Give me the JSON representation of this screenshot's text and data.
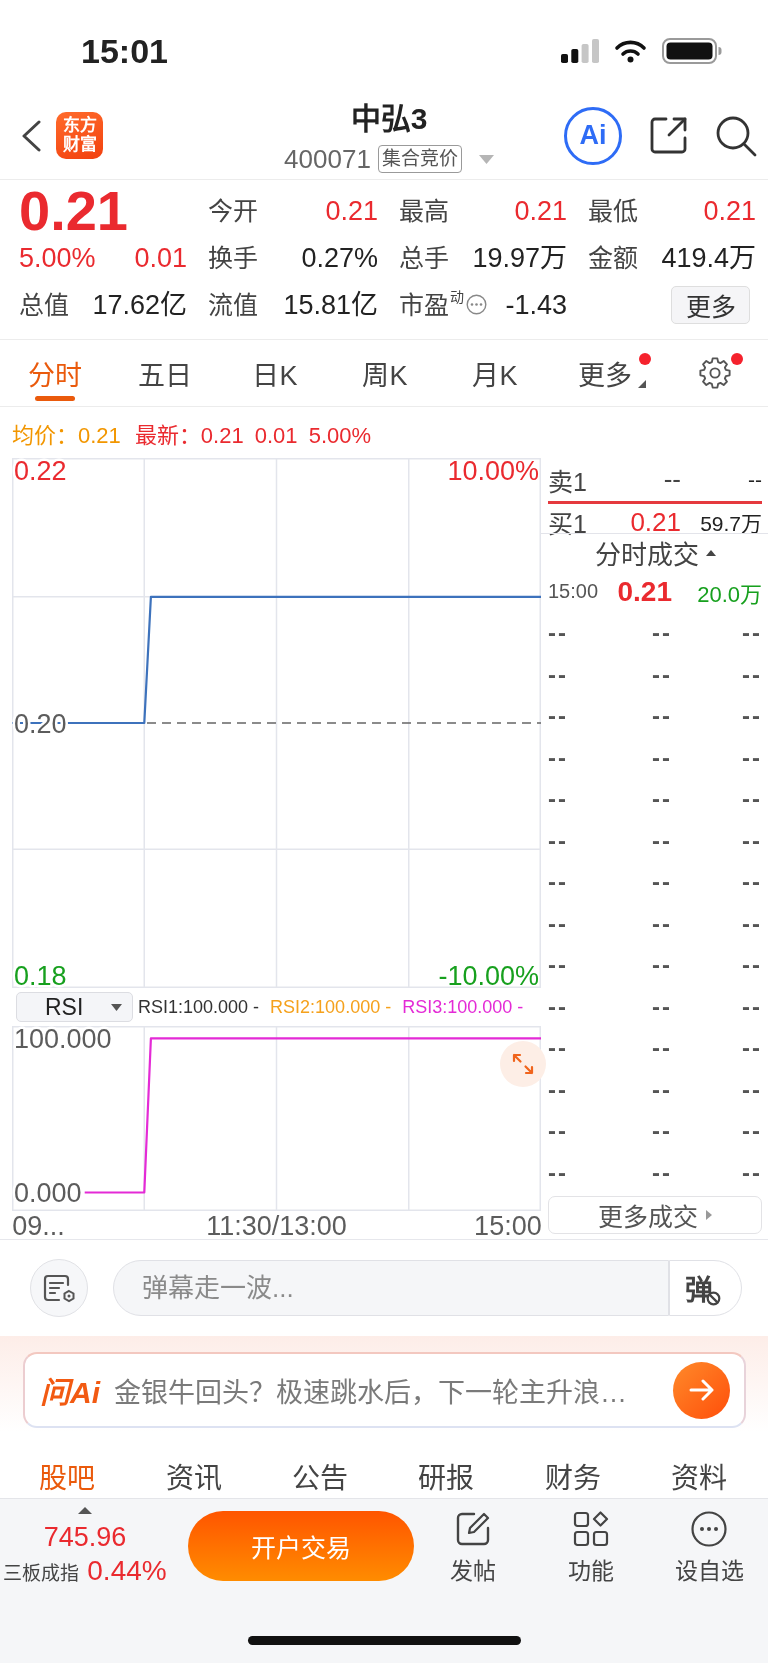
{
  "status_bar": {
    "time": "15:01"
  },
  "header": {
    "logo_text": "东方财富",
    "title": "中弘3",
    "code": "400071",
    "tag": "集合竞价",
    "ai_label": "Ai"
  },
  "quote": {
    "price": "0.21",
    "change_pct": "5.00%",
    "change": "0.01",
    "color": "#ea2a2f",
    "stats": [
      {
        "label": "今开",
        "value": "0.21",
        "color": "#ea2a2f"
      },
      {
        "label": "最高",
        "value": "0.21",
        "color": "#ea2a2f"
      },
      {
        "label": "最低",
        "value": "0.21",
        "color": "#ea2a2f"
      },
      {
        "label": "换手",
        "value": "0.27%",
        "color": "#222222"
      },
      {
        "label": "总手",
        "value": "19.97万",
        "color": "#222222"
      },
      {
        "label": "金额",
        "value": "419.4万",
        "color": "#222222"
      }
    ],
    "totals": [
      {
        "label": "总值",
        "value": "17.62亿"
      },
      {
        "label": "流值",
        "value": "15.81亿"
      },
      {
        "label": "市盈$^{动}$",
        "value": "-1.43",
        "hint_icon": true
      }
    ],
    "more_button": "更多"
  },
  "chart_tabs": [
    {
      "label": "分时",
      "selected": true,
      "kind": "tab",
      "dot": false
    },
    {
      "label": "五日",
      "selected": false,
      "kind": "tab",
      "dot": false
    },
    {
      "label": "日K",
      "selected": false,
      "kind": "tab",
      "dot": false
    },
    {
      "label": "周K",
      "selected": false,
      "kind": "tab",
      "dot": false
    },
    {
      "label": "月K",
      "selected": false,
      "kind": "tab",
      "dot": false
    },
    {
      "label": "更多",
      "selected": false,
      "kind": "menu",
      "dot": true
    }
  ],
  "settings": {
    "dot": true
  },
  "summary": [
    {
      "text": "均价：0.21",
      "color": "#f29600"
    },
    {
      "text": "最新：0.21 0.01 5.00%",
      "color": "#ea2a2f"
    }
  ],
  "price_chart": {
    "percent_labels": [
      {
        "text": "10.00%",
        "color": "#ea2a2f"
      },
      {
        "text": "-10.00%",
        "color": "#17a01e"
      }
    ],
    "chart_data": {
      "type": "line",
      "grid": true,
      "categories": [
        null,
        null,
        null,
        null,
        null,
        null,
        null,
        null,
        null,
        null,
        null,
        null,
        null,
        null,
        null,
        null,
        null,
        null,
        null,
        null,
        null,
        null,
        null,
        null,
        null,
        null,
        null,
        null,
        null,
        null,
        null,
        null,
        null,
        null,
        null,
        null,
        null,
        null,
        null,
        null,
        null,
        null,
        null,
        null,
        null,
        null,
        null,
        null,
        null,
        null,
        null,
        null,
        null,
        null,
        null,
        null,
        null,
        null,
        null,
        null,
        null,
        null,
        null,
        null,
        null,
        null,
        null,
        null,
        null,
        null,
        null,
        null,
        null,
        null,
        null,
        null,
        null,
        null,
        null,
        null,
        null
      ],
      "ylim": [
        0.179,
        0.221
      ],
      "yticks": [
        {
          "value": 0.18,
          "label": "0.18"
        },
        {
          "value": 0.2,
          "label": "0.20"
        },
        {
          "value": 0.22,
          "label": "0.22"
        }
      ],
      "series": [
        {
          "color": "#3d72bc",
          "values": [
            0.2,
            0.2,
            0.2,
            0.2,
            0.2,
            0.2,
            0.2,
            0.2,
            0.2,
            0.2,
            0.2,
            0.2,
            0.2,
            0.2,
            0.2,
            0.2,
            0.2,
            0.2,
            0.2,
            0.2,
            0.2,
            0.21,
            0.21,
            0.21,
            0.21,
            0.21,
            0.21,
            0.21,
            0.21,
            0.21,
            0.21,
            0.21,
            0.21,
            0.21,
            0.21,
            0.21,
            0.21,
            0.21,
            0.21,
            0.21,
            0.21,
            0.21,
            0.21,
            0.21,
            0.21,
            0.21,
            0.21,
            0.21,
            0.21,
            0.21,
            0.21,
            0.21,
            0.21,
            0.21,
            0.21,
            0.21,
            0.21,
            0.21,
            0.21,
            0.21,
            0.21,
            0.21,
            0.21,
            0.21,
            0.21,
            0.21,
            0.21,
            0.21,
            0.21,
            0.21,
            0.21,
            0.21,
            0.21,
            0.21,
            0.21,
            0.21,
            0.21,
            0.21,
            0.21,
            0.21,
            0.21
          ]
        }
      ],
      "ref_lines": [
        {
          "axis": "y",
          "value": 0.2
        }
      ]
    }
  },
  "rsi": {
    "indicator": "RSI",
    "legend": [
      {
        "text": "RSI1:100.000 -",
        "color": "#333333"
      },
      {
        "text": "RSI2:100.000 -",
        "color": "#f5a11c"
      },
      {
        "text": "RSI3:100.000 -",
        "color": "#e42ad6"
      }
    ],
    "chart_data": {
      "type": "line",
      "grid": true,
      "categories": [
        null,
        null,
        null,
        null,
        "09...",
        null,
        null,
        null,
        null,
        null,
        null,
        null,
        null,
        null,
        null,
        null,
        null,
        null,
        null,
        null,
        null,
        null,
        null,
        null,
        null,
        null,
        null,
        null,
        null,
        null,
        null,
        null,
        null,
        null,
        null,
        null,
        null,
        null,
        null,
        null,
        "11:30/13:00",
        null,
        null,
        null,
        null,
        null,
        null,
        null,
        null,
        null,
        null,
        null,
        null,
        null,
        null,
        null,
        null,
        null,
        null,
        null,
        null,
        null,
        null,
        null,
        null,
        null,
        null,
        null,
        null,
        null,
        null,
        null,
        null,
        null,
        null,
        "15:00",
        null,
        null,
        null,
        null,
        null
      ],
      "ylim": [
        -12,
        108
      ],
      "yticks": [
        {
          "value": 0,
          "label": "0.000"
        },
        {
          "value": 100,
          "label": "100.000"
        }
      ],
      "series": [
        {
          "color": "#e42ad6",
          "values": [
            null,
            null,
            null,
            null,
            null,
            null,
            null,
            null,
            null,
            null,
            null,
            0,
            0,
            0,
            0,
            0,
            0,
            0,
            0,
            0,
            0,
            100,
            100,
            100,
            100,
            100,
            100,
            100,
            100,
            100,
            100,
            100,
            100,
            100,
            100,
            100,
            100,
            100,
            100,
            100,
            100,
            100,
            100,
            100,
            100,
            100,
            100,
            100,
            100,
            100,
            100,
            100,
            100,
            100,
            100,
            100,
            100,
            100,
            100,
            100,
            100,
            100,
            100,
            100,
            100,
            100,
            100,
            100,
            100,
            100,
            100,
            100,
            100,
            100,
            100,
            100,
            100,
            100,
            100,
            100,
            100
          ]
        }
      ]
    }
  },
  "book": {
    "asks": [
      {
        "label": "卖1",
        "price": "--",
        "volume": "--",
        "color": "#444444"
      }
    ],
    "bids": [
      {
        "label": "买1",
        "price": "0.21",
        "volume": "59.7万",
        "color": "#ea2a2f"
      }
    ]
  },
  "trades": {
    "title": "分时成交",
    "rows": [
      {
        "kind": "trade",
        "cells": [
          {
            "text": "15:00"
          },
          {
            "text": "0.21",
            "color": "#ea2a2f"
          },
          {
            "text": "20.0万",
            "color": "#17a01e"
          }
        ]
      },
      {
        "kind": "empty",
        "cells": [
          {
            "text": "--"
          },
          {
            "text": "--"
          },
          {
            "text": "--"
          }
        ]
      },
      {
        "kind": "empty",
        "cells": [
          {
            "text": "--"
          },
          {
            "text": "--"
          },
          {
            "text": "--"
          }
        ]
      },
      {
        "kind": "empty",
        "cells": [
          {
            "text": "--"
          },
          {
            "text": "--"
          },
          {
            "text": "--"
          }
        ]
      },
      {
        "kind": "empty",
        "cells": [
          {
            "text": "--"
          },
          {
            "text": "--"
          },
          {
            "text": "--"
          }
        ]
      },
      {
        "kind": "empty",
        "cells": [
          {
            "text": "--"
          },
          {
            "text": "--"
          },
          {
            "text": "--"
          }
        ]
      },
      {
        "kind": "empty",
        "cells": [
          {
            "text": "--"
          },
          {
            "text": "--"
          },
          {
            "text": "--"
          }
        ]
      },
      {
        "kind": "empty",
        "cells": [
          {
            "text": "--"
          },
          {
            "text": "--"
          },
          {
            "text": "--"
          }
        ]
      },
      {
        "kind": "empty",
        "cells": [
          {
            "text": "--"
          },
          {
            "text": "--"
          },
          {
            "text": "--"
          }
        ]
      },
      {
        "kind": "empty",
        "cells": [
          {
            "text": "--"
          },
          {
            "text": "--"
          },
          {
            "text": "--"
          }
        ]
      },
      {
        "kind": "empty",
        "cells": [
          {
            "text": "--"
          },
          {
            "text": "--"
          },
          {
            "text": "--"
          }
        ]
      },
      {
        "kind": "empty",
        "cells": [
          {
            "text": "--"
          },
          {
            "text": "--"
          },
          {
            "text": "--"
          }
        ]
      },
      {
        "kind": "empty",
        "cells": [
          {
            "text": "--"
          },
          {
            "text": "--"
          },
          {
            "text": "--"
          }
        ]
      },
      {
        "kind": "empty",
        "cells": [
          {
            "text": "--"
          },
          {
            "text": "--"
          },
          {
            "text": "--"
          }
        ]
      },
      {
        "kind": "empty",
        "cells": [
          {
            "text": "--"
          },
          {
            "text": "--"
          },
          {
            "text": "--"
          }
        ]
      }
    ],
    "more_button": "更多成交"
  },
  "comment_bar": {
    "placeholder": "弹幕走一波...",
    "send_label": "弹",
    "danmaku_muted": true
  },
  "ask_ai": {
    "logo": "问Ai",
    "prompt": "金银牛回头？极速跳水后，下一轮主升浪…"
  },
  "section_tabs": [
    {
      "label": "股吧",
      "selected": true
    },
    {
      "label": "资讯",
      "selected": false
    },
    {
      "label": "公告",
      "selected": false
    },
    {
      "label": "研报",
      "selected": false
    },
    {
      "label": "财务",
      "selected": false
    },
    {
      "label": "资料",
      "selected": false
    }
  ],
  "bottom_bar": {
    "index": {
      "value": "745.96",
      "name": "三板成指",
      "change": "0.44%",
      "color": "#ea2a2f"
    },
    "trade_button": "开户交易",
    "actions": [
      {
        "label": "发帖",
        "kind": "post"
      },
      {
        "label": "功能",
        "kind": "apps"
      },
      {
        "label": "设自选",
        "kind": "watchlist"
      }
    ]
  }
}
